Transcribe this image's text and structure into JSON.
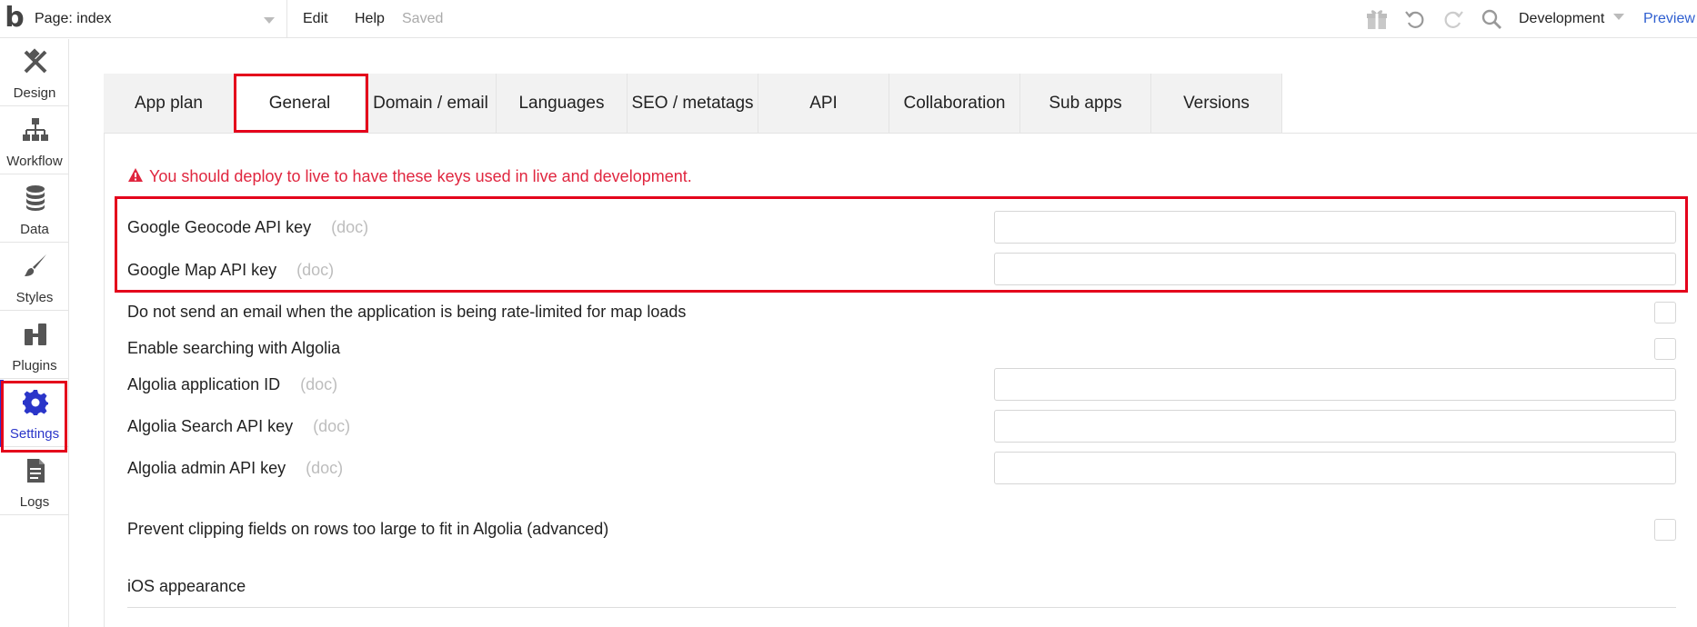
{
  "topbar": {
    "logo": "b",
    "page_select": "Page: index",
    "menu": {
      "edit": "Edit",
      "help": "Help",
      "saved": "Saved"
    },
    "icons": [
      "gift-icon",
      "undo-icon",
      "redo-icon",
      "search-icon"
    ],
    "environment": "Development",
    "preview": "Preview"
  },
  "sidebar": {
    "items": [
      {
        "label": "Design",
        "icon": "design-icon"
      },
      {
        "label": "Workflow",
        "icon": "workflow-icon"
      },
      {
        "label": "Data",
        "icon": "database-icon"
      },
      {
        "label": "Styles",
        "icon": "brush-icon"
      },
      {
        "label": "Plugins",
        "icon": "plugin-icon"
      },
      {
        "label": "Settings",
        "icon": "gear-icon",
        "active": true
      },
      {
        "label": "Logs",
        "icon": "document-icon"
      }
    ]
  },
  "tabs": [
    {
      "label": "App plan"
    },
    {
      "label": "General",
      "active": true
    },
    {
      "label": "Domain / email"
    },
    {
      "label": "Languages"
    },
    {
      "label": "SEO / metatags"
    },
    {
      "label": "API"
    },
    {
      "label": "Collaboration"
    },
    {
      "label": "Sub apps"
    },
    {
      "label": "Versions"
    }
  ],
  "content": {
    "warning": "You should deploy to live to have these keys used in live and development.",
    "doc_label": "(doc)",
    "rows": {
      "geocode_key": {
        "label": "Google Geocode API key",
        "value": ""
      },
      "map_key": {
        "label": "Google Map API key",
        "value": ""
      },
      "rate_limit_email": {
        "label": "Do not send an email when the application is being rate-limited for map loads",
        "checked": false
      },
      "algolia_enable": {
        "label": "Enable searching with Algolia",
        "checked": false
      },
      "algolia_app_id": {
        "label": "Algolia application ID",
        "value": ""
      },
      "algolia_search_key": {
        "label": "Algolia Search API key",
        "value": ""
      },
      "algolia_admin_key": {
        "label": "Algolia admin API key",
        "value": ""
      },
      "prevent_clipping": {
        "label": "Prevent clipping fields on rows too large to fit in Algolia (advanced)",
        "checked": false
      },
      "ios_appearance": {
        "label": "iOS appearance"
      }
    }
  },
  "colors": {
    "accent": "#2a35c9",
    "warning": "#e0263f",
    "highlight": "#e4001b",
    "link": "#2f5fd0"
  }
}
